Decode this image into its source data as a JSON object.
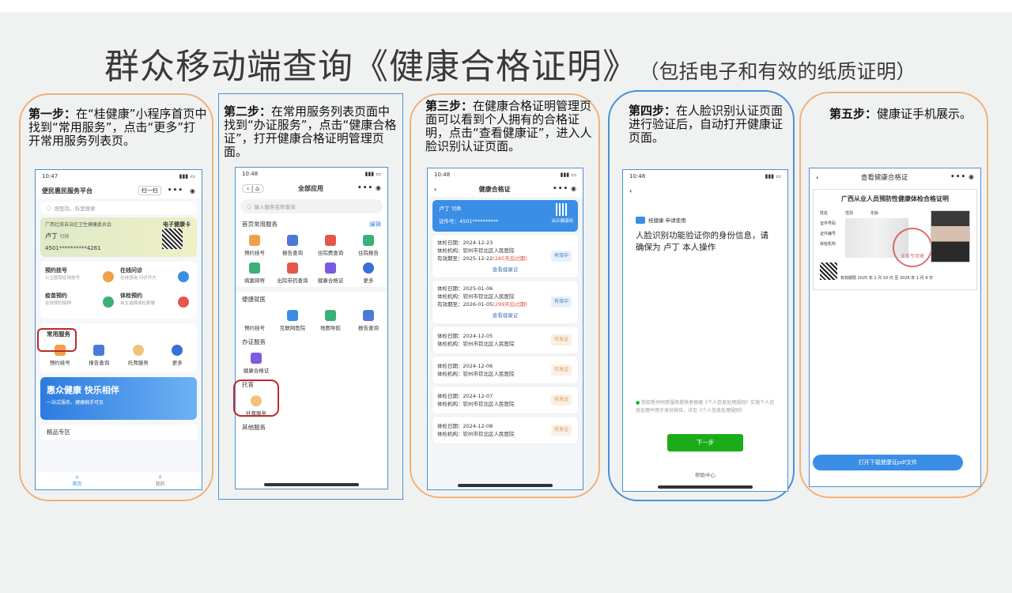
{
  "page": {
    "title": "群众移动端查询《健康合格证明》",
    "subtitle": "（包括电子和有效的纸质证明）"
  },
  "steps": [
    {
      "label": "第一步：",
      "text": "在“桂健康”小程序首页中找到“常用服务”，点击“更多”打开常用服务列表页。"
    },
    {
      "label": "第二步：",
      "text": "在常用服务列表页面中找到“办证服务”，点击“健康合格证”，打开健康合格证明管理页面。"
    },
    {
      "label": "第三步：",
      "text": "在健康合格证明管理页面可以看到个人拥有的合格证明，点击“查看健康证”，进入人脸识别认证页面。"
    },
    {
      "label": "第四步：",
      "text": "在人脸识别认证页面进行验证后，自动打开健康证页面。"
    },
    {
      "label": "第五步：",
      "text": "健康证手机展示。"
    }
  ],
  "screen1": {
    "time": "10:47",
    "signal": "▮▮▮ ▭",
    "app_title": "便民惠民服务平台",
    "scan": "扫一扫",
    "search_placeholder": "按医院、科室搜索",
    "card_org": "广西壮族自治区卫生健康委员会",
    "card_type": "电子健康卡",
    "card_name": "卢丁",
    "card_switch": "切换",
    "card_no": "4501**********4261",
    "tiles": [
      {
        "title": "预约挂号",
        "sub": "公立医院在线挂号"
      },
      {
        "title": "在线问诊",
        "sub": "在线咨询 问诊开方"
      },
      {
        "title": "疫苗预约",
        "sub": "在线预约接种"
      },
      {
        "title": "体检预约",
        "sub": "自主选择体检套餐"
      }
    ],
    "common_title": "常用服务",
    "common": [
      "预约挂号",
      "报告查询",
      "托育服务",
      "更多"
    ],
    "banner_title": "惠众健康 快乐相伴",
    "banner_sub": "一站式服务，健康触手可及",
    "featured": "精品专区",
    "tab_home": "首页",
    "tab_mine": "我的"
  },
  "screen2": {
    "time": "10:48",
    "title": "全部应用",
    "search_placeholder": "输入服务名称查询",
    "sec_common": "首页常用服务",
    "edit": "编辑",
    "common": [
      "预约挂号",
      "报告查询",
      "住院费查询",
      "住院报告",
      "病案邮寄",
      "出院带药查询",
      "健康合格证",
      "更多"
    ],
    "sec_convenient": "便捷就医",
    "convenient": [
      "预约挂号",
      "互联网医院",
      "地图导航",
      "报告查询"
    ],
    "sec_cert": "办证服务",
    "cert": [
      "健康合格证"
    ],
    "sec_childcare": "托育",
    "childcare": [
      "托育服务"
    ],
    "sec_other": "其他服务"
  },
  "screen3": {
    "time": "10:48",
    "title": "健康合格证",
    "name": "卢丁",
    "switch": "切换",
    "cert_no": "证件号：4501**********",
    "qr_label": "出示健康码",
    "records": [
      {
        "date": "体检日期：2024-12-23",
        "org": "体检机构：钦州市钦北区人民医院",
        "valid": "有效期至：2025-12-22",
        "remain": "(285天后过期)",
        "status": "有效中",
        "kind": "valid",
        "link": "查看健康证"
      },
      {
        "date": "体检日期：2025-01-06",
        "org": "体检机构：钦州市钦北区人民医院",
        "valid": "有效期至：2026-01-05",
        "remain": "(299天后过期)",
        "status": "有效中",
        "kind": "valid",
        "link": "查看健康证"
      },
      {
        "date": "体检日期：2024-12-05",
        "org": "体检机构：钦州市钦北区人民医院",
        "status": "待发证",
        "kind": "pending"
      },
      {
        "date": "体检日期：2024-12-06",
        "org": "体检机构：钦州市钦北区人民医院",
        "status": "待发证",
        "kind": "pending"
      },
      {
        "date": "体检日期：2024-12-07",
        "org": "体检机构：钦州市钦北区人民医院",
        "status": "待发证",
        "kind": "pending"
      },
      {
        "date": "体检日期：2024-12-08",
        "org": "体检机构：钦州市钦北区人民医院",
        "status": "待发证",
        "kind": "pending"
      }
    ]
  },
  "screen4": {
    "time": "10:48",
    "apply_line": "桂健康 申请使用",
    "face_text": "人脸识别功能验证你的身份信息，请确保为 卢丁 本人操作",
    "agree_text": "我知悉并同意服务提供者根据《个人信息处理规则》实施个人信息处理并用于身份核验，详见《个人信息处理规则》",
    "next_btn": "下一步",
    "help": "帮助中心"
  },
  "screen5": {
    "title": "查看健康合格证",
    "cert_title": "广西从业人员预防性健康体检合格证明",
    "fields": [
      "姓名",
      "性别",
      "年龄",
      "证件号码",
      "证件编号",
      "体检机构"
    ],
    "stamp": "业务专用章",
    "valid_period": "有效期限 2025 年 1 月 10 日 至 2026 年 1 月 9 日",
    "download_btn": "打开下载健康证pdf文件"
  },
  "colors": {
    "accent": "#3a8ee6",
    "panel_orange": "#f0b07c",
    "panel_blue": "#4a90d9",
    "highlight": "#c02a2a",
    "green": "#1aad19"
  }
}
